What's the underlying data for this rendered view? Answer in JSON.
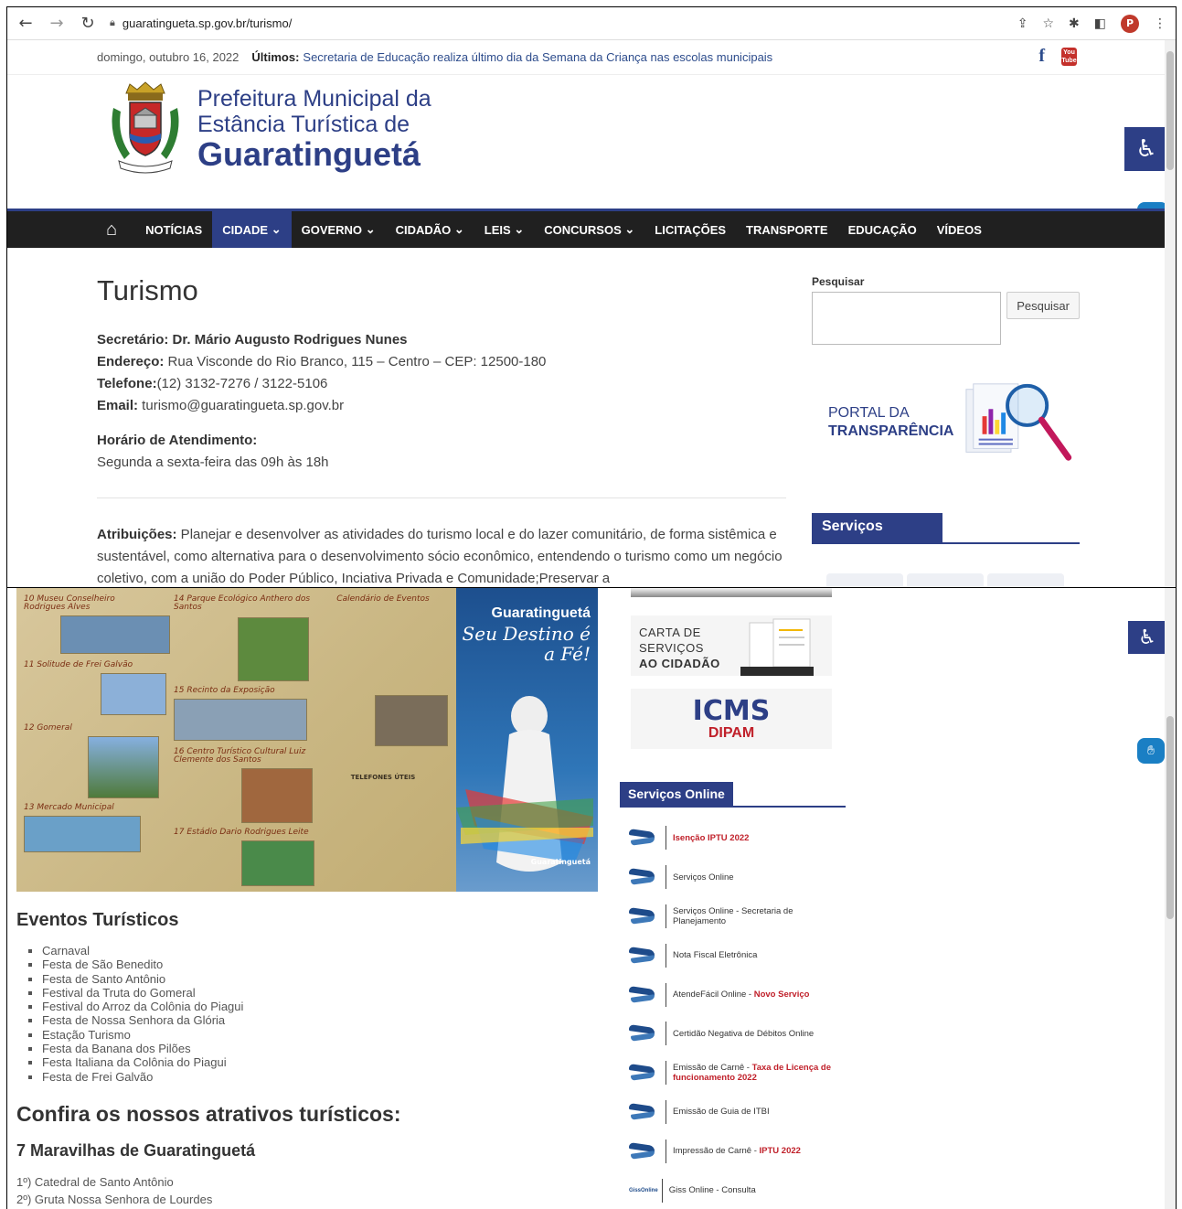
{
  "browser": {
    "url": "guaratingueta.sp.gov.br/turismo/",
    "profile_initial": "P"
  },
  "topbar": {
    "date": "domingo, outubro 16, 2022",
    "latest_label": "Últimos:",
    "latest_news": "Secretaria de Educação realiza último dia da Semana da Criança nas escolas municipais",
    "youtube_label": "You Tube"
  },
  "header": {
    "line1": "Prefeitura Municipal da",
    "line2": "Estância Turística de",
    "line3": "Guaratinguetá"
  },
  "nav": {
    "items": [
      {
        "label": "NOTÍCIAS",
        "dropdown": false
      },
      {
        "label": "CIDADE",
        "dropdown": true
      },
      {
        "label": "GOVERNO",
        "dropdown": true
      },
      {
        "label": "CIDADÃO",
        "dropdown": true
      },
      {
        "label": "LEIS",
        "dropdown": true
      },
      {
        "label": "CONCURSOS",
        "dropdown": true
      },
      {
        "label": "LICITAÇÕES",
        "dropdown": false
      },
      {
        "label": "TRANSPORTE",
        "dropdown": false
      },
      {
        "label": "EDUCAÇÃO",
        "dropdown": false
      },
      {
        "label": "VÍDEOS",
        "dropdown": false
      }
    ]
  },
  "main": {
    "title": "Turismo",
    "secretary_label": "Secretário: Dr. Mário Augusto Rodrigues Nunes",
    "address_label": "Endereço:",
    "address": " Rua Visconde do Rio Branco, 115 – Centro – CEP: 12500-180",
    "phone_label": "Telefone:",
    "phone": "(12) 3132-7276 / 3122-5106",
    "email_label": "Email:",
    "email": " turismo@guaratingueta.sp.gov.br",
    "hours_label": "Horário de Atendimento:",
    "hours": "Segunda a sexta-feira das 09h às 18h",
    "attr_label": "Atribuições:",
    "attr_text": " Planejar e desenvolver as atividades do turismo local e do lazer comunitário, de forma sistêmica e sustentável, como alternativa para o desenvolvimento sócio econômico, entendendo o turismo como um negócio coletivo, com a união do Poder Público, Inciativa Privada e Comunidade;Preservar a"
  },
  "sidebar": {
    "search_label": "Pesquisar",
    "search_button": "Pesquisar",
    "portal_line1": "PORTAL DA",
    "portal_line2": "TRANSPARÊNCIA",
    "services_title": "Serviços"
  },
  "brochure": {
    "title_top": "Guaratinguetá",
    "title_mid": "Seu Destino é",
    "title_bot": "a Fé!",
    "logo_text": "Guaratinguetá",
    "sections": [
      "10 Museu Conselheiro Rodrigues Alves",
      "11 Solitude de Frei Galvão",
      "12 Gomeral",
      "13 Mercado Municipal",
      "14 Parque Ecológico Anthero dos Santos",
      "15 Recinto da Exposição",
      "16 Centro Turístico Cultural Luiz Clemente dos Santos",
      "17 Estádio Dario Rodrigues Leite",
      "Calendário de Eventos",
      "TELEFONES ÚTEIS"
    ]
  },
  "events": {
    "title": "Eventos Turísticos",
    "items": [
      "Carnaval",
      "Festa de São Benedito",
      "Festa de Santo Antônio",
      "Festival da Truta do Gomeral",
      "Festival do Arroz da Colônia do Piagui",
      "Festa de Nossa Senhora da Glória",
      "Estação Turismo",
      "Festa da Banana dos Pilões",
      "Festa Italiana da Colônia do Piagui",
      "Festa de Frei Galvão"
    ],
    "attractions_title": "Confira os nossos atrativos turísticos:",
    "wonders_title": "7 Maravilhas de Guaratinguetá",
    "wonders": [
      "1º) Catedral de Santo Antônio",
      "2º) Gruta Nossa Senhora de Lourdes"
    ]
  },
  "cards": {
    "carta_line1": "CARTA DE",
    "carta_line2": "SERVIÇOS",
    "carta_line3": "AO CIDADÃO",
    "icms": "ICMS",
    "dipam": "DIPAM"
  },
  "online": {
    "title": "Serviços Online",
    "items": [
      {
        "text": "",
        "red": "Isenção IPTU 2022"
      },
      {
        "text": "Serviços Online",
        "red": ""
      },
      {
        "text": "Serviços Online - Secretaria de Planejamento",
        "red": ""
      },
      {
        "text": "Nota Fiscal Eletrônica",
        "red": ""
      },
      {
        "text": "AtendeFácil Online - ",
        "red": "Novo Serviço"
      },
      {
        "text": "Certidão Negativa de Débitos Online",
        "red": ""
      },
      {
        "text": "Emissão de Carnê - ",
        "red": "Taxa de Licença de funcionamento 2022"
      },
      {
        "text": "Emissão de Guia de ITBI",
        "red": ""
      },
      {
        "text": "Impressão de Carnê - ",
        "red": "IPTU 2022"
      },
      {
        "text": "Giss Online - Consulta",
        "red": ""
      }
    ],
    "giss_logo": "GissOnline"
  },
  "colors": {
    "brand": "#2d3f86",
    "navbar": "#202020",
    "accent_red": "#c0202a"
  }
}
